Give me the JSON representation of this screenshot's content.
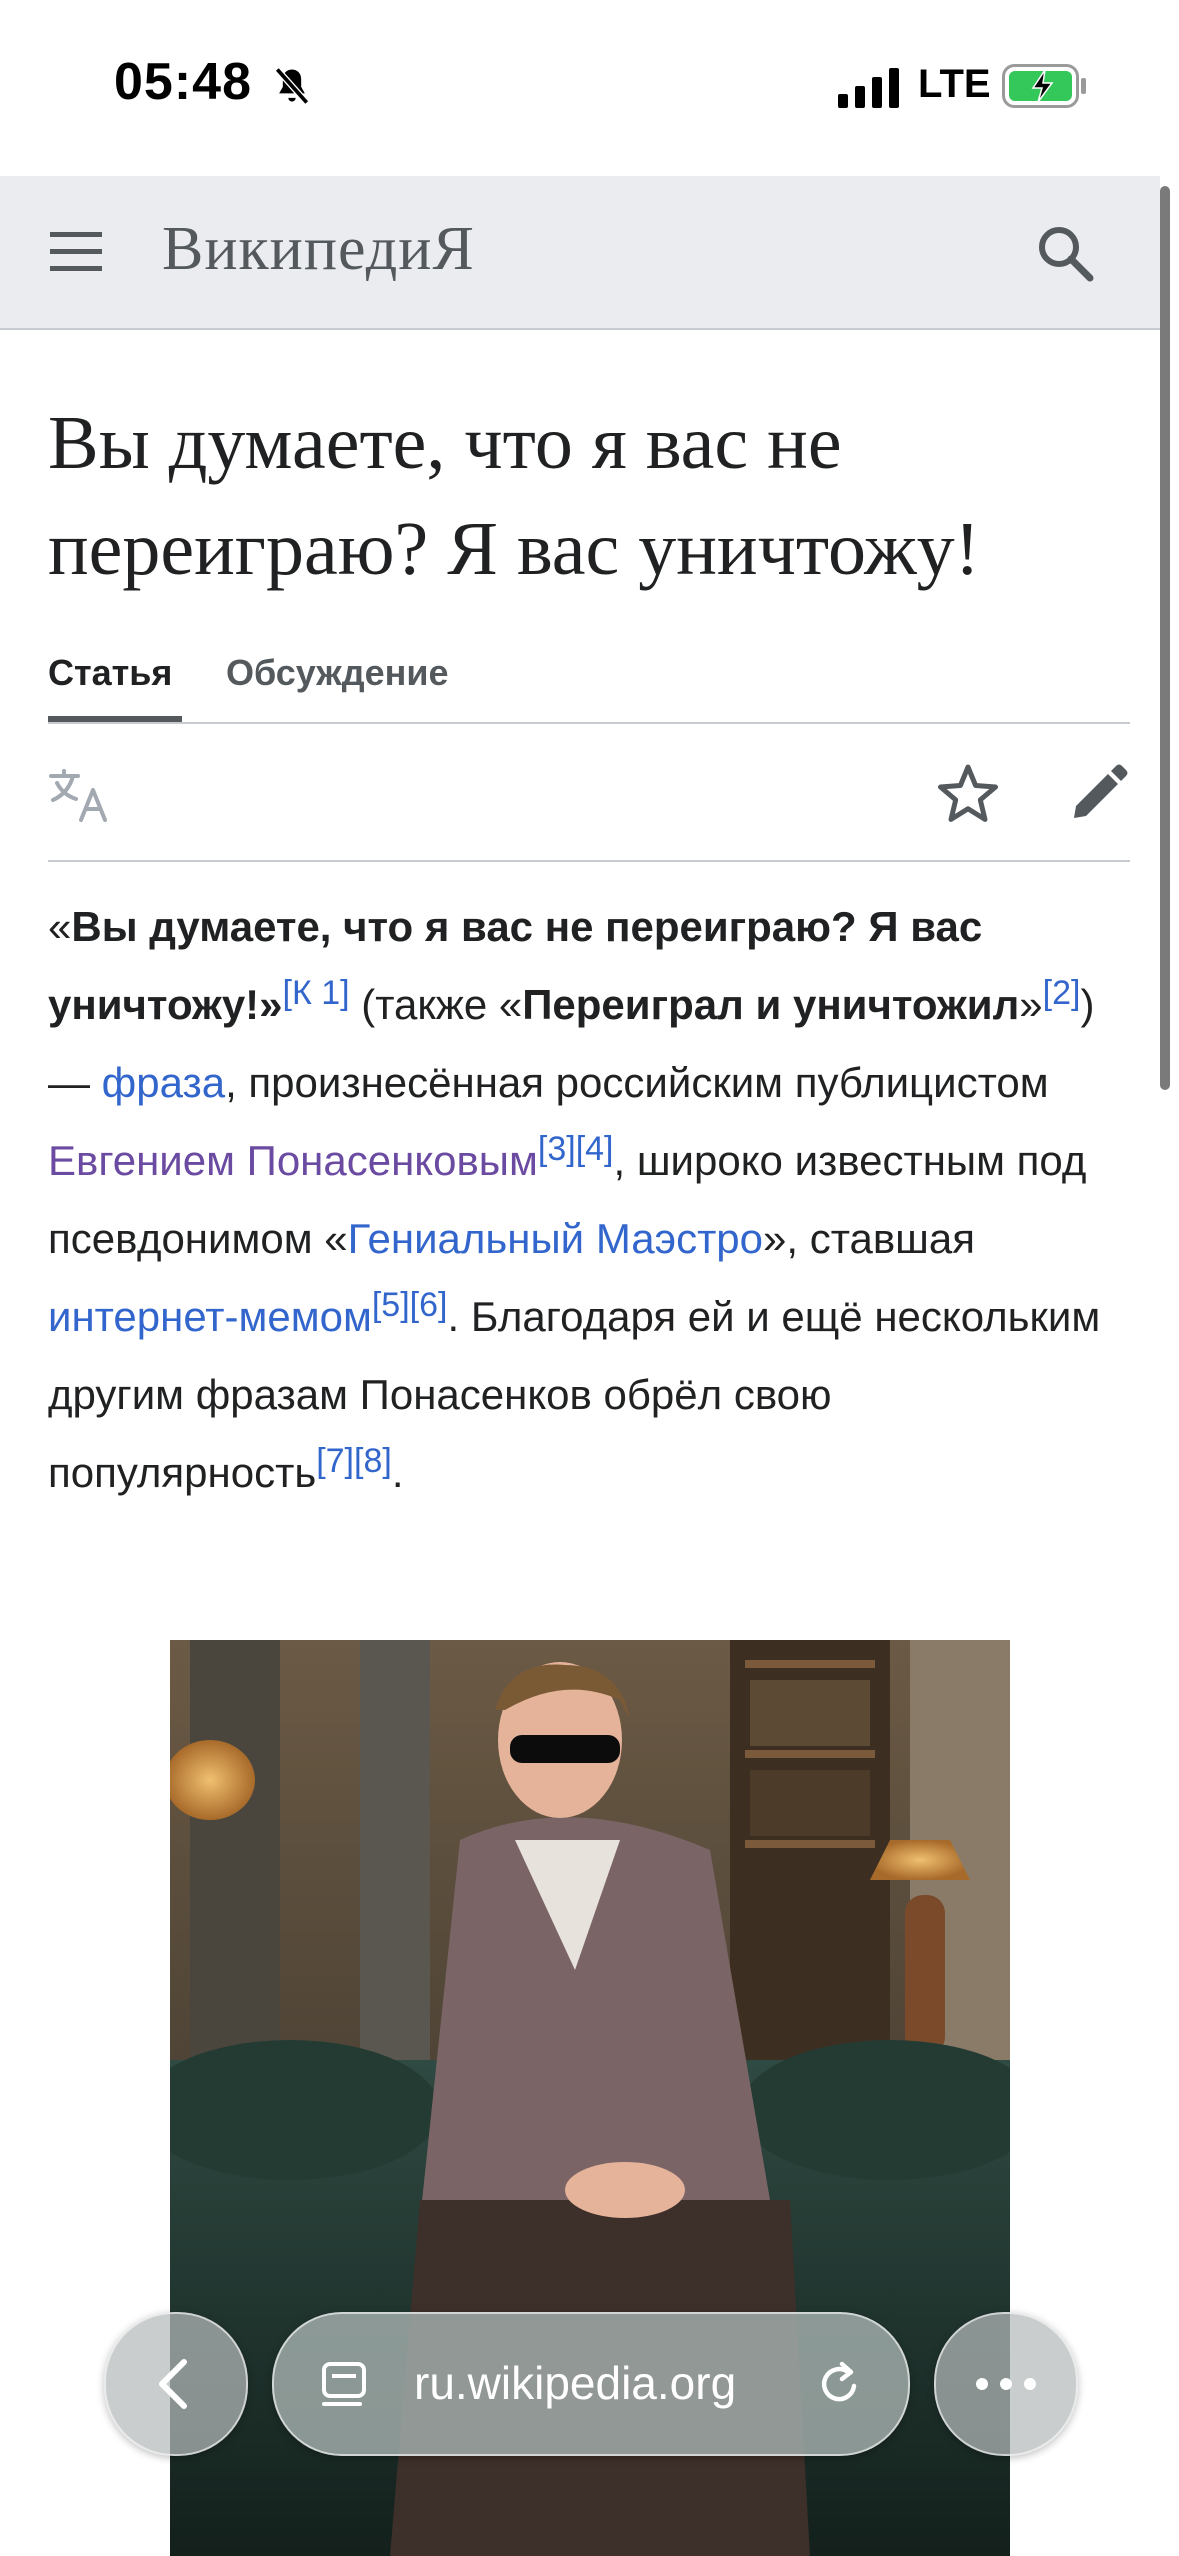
{
  "status": {
    "time": "05:48",
    "network": "LTE"
  },
  "header": {
    "logo": "ВикипедиЯ"
  },
  "article": {
    "title": "Вы думаете, что я вас не переиграю? Я вас уничтожу!",
    "tabs": [
      {
        "label": "Статья"
      },
      {
        "label": "Обсуждение"
      }
    ],
    "lead": {
      "q_open": "«",
      "phrase": "Вы думаете, что я вас не переиграю? Я вас уничтожу!",
      "q_close": "»",
      "ref_k1": "[К 1]",
      "also": " (также «",
      "alt_phrase": "Переиграл и уничтожил",
      "alt_close": "»",
      "ref_2": "[2]",
      "dash": ") — ",
      "link_phrase": "фраза",
      "t1": ", произнесённая российским публицистом ",
      "link_person": "Евгением Понасенковым",
      "ref_3": "[3]",
      "ref_4": "[4]",
      "t2": ", широко известным под псевдонимом «",
      "link_maestro": "Гениальный Маэстро",
      "t3": "», ставшая ",
      "link_meme": "интернет-мемом",
      "ref_5": "[5]",
      "ref_6": "[6]",
      "t4": ". Благодаря ей и ещё нескольким другим фразам Понасенков обрёл свою популярность",
      "ref_7": "[7]",
      "ref_8": "[8]",
      "t5": "."
    }
  },
  "browser": {
    "url": "ru.wikipedia.org"
  },
  "colors": {
    "link": "#3366cc",
    "visited_link": "#6b4ba1",
    "header_bg": "#eaecf0"
  }
}
